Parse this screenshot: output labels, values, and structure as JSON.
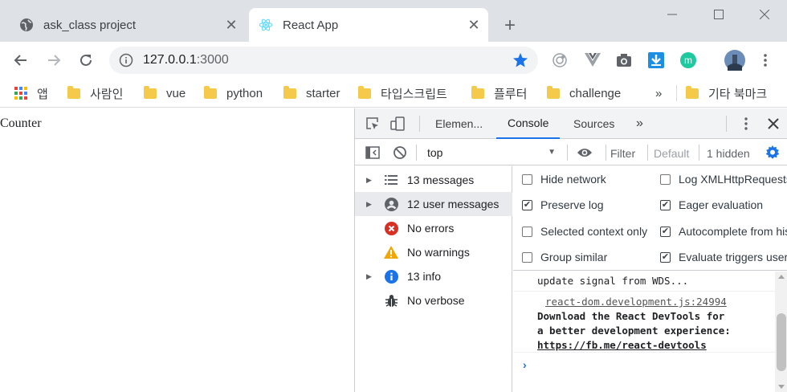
{
  "browser": {
    "tabs": [
      {
        "title": "ask_class project",
        "icon": "globe-icon",
        "active": false
      },
      {
        "title": "React App",
        "icon": "react-icon",
        "active": true
      }
    ],
    "new_tab_symbol": "+",
    "url": {
      "host": "127.0.0.1",
      "port": ":3000"
    }
  },
  "bookmarks": {
    "apps_label": "앱",
    "items": [
      "사람인",
      "vue",
      "python",
      "starter",
      "타입스크립트",
      "플루터",
      "challenge"
    ],
    "overflow_symbol": "»",
    "other_label": "기타 북마크"
  },
  "page": {
    "heading": "Counter"
  },
  "devtools": {
    "tabs": [
      "Elemen...",
      "Console",
      "Sources"
    ],
    "more_tabs_symbol": "»",
    "active_tab": "Console",
    "context": "top",
    "filter_placeholder": "Filter",
    "level": "Default",
    "hidden": "1 hidden",
    "sidebar": [
      {
        "label": "13 messages",
        "icon": "list-icon",
        "color": "#5f6368",
        "expandable": true
      },
      {
        "label": "12 user messages",
        "icon": "user-icon",
        "color": "#5f6368",
        "expandable": true
      },
      {
        "label": "No errors",
        "icon": "error-icon",
        "color": "#d93025",
        "expandable": false
      },
      {
        "label": "No warnings",
        "icon": "warning-icon",
        "color": "#f2a600",
        "expandable": false
      },
      {
        "label": "13 info",
        "icon": "info-icon",
        "color": "#1a73e8",
        "expandable": true
      },
      {
        "label": "No verbose",
        "icon": "bug-icon",
        "color": "#5f6368",
        "expandable": false
      }
    ],
    "options_left": [
      {
        "label": "Hide network",
        "checked": false
      },
      {
        "label": "Preserve log",
        "checked": true
      },
      {
        "label": "Selected context only",
        "checked": false
      },
      {
        "label": "Group similar",
        "checked": false
      }
    ],
    "options_right": [
      {
        "label": "Log XMLHttpRequests",
        "checked": false
      },
      {
        "label": "Eager evaluation",
        "checked": true
      },
      {
        "label": "Autocomplete from history",
        "checked": true
      },
      {
        "label": "Evaluate triggers user activation",
        "checked": true
      }
    ],
    "console": {
      "partial_line": "update signal from WDS...",
      "source_link": "react-dom.development.js:24994",
      "message_lines": [
        "Download the React DevTools for",
        "a better development experience:"
      ],
      "message_url": "https://fb.me/react-devtools",
      "prompt": "›"
    }
  }
}
